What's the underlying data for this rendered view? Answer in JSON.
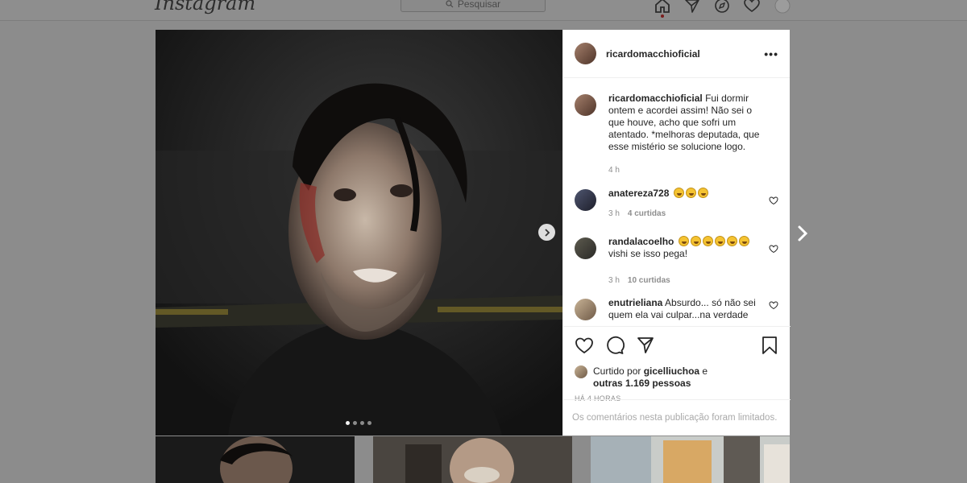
{
  "app": {
    "logo_text": "Instagram"
  },
  "search": {
    "placeholder": "Pesquisar",
    "icon": "search-icon"
  },
  "nav": {
    "icons": [
      "home-icon",
      "direct-icon",
      "explore-icon",
      "activity-heart-icon",
      "profile-avatar"
    ]
  },
  "post": {
    "username": "ricardomacchioficial",
    "more_label": "•••",
    "carousel": {
      "total": 4,
      "current": 1
    },
    "caption": {
      "user": "ricardomacchioficial",
      "text": "Fui dormir ontem e acordei assim! Não sei o que houve, acho que sofri um atentado. *melhoras deputada, que esse mistério se solucione logo.",
      "time": "4 h"
    },
    "comments": [
      {
        "user": "anatereza728",
        "text": "",
        "emoji_count": 3,
        "time": "3 h",
        "likes": "4 curtidas"
      },
      {
        "user": "randalacoelho",
        "text": "vishi se isso pega!",
        "emoji_count": 6,
        "time": "3 h",
        "likes": "10 curtidas"
      },
      {
        "user": "enutrieliana",
        "text": "Absurdo... só não sei quem ela vai culpar...na verdade",
        "emoji_count": 0,
        "time": "",
        "likes": ""
      }
    ],
    "liked_by": {
      "prefix": "Curtido por",
      "user": "gicelliuchoa",
      "suffix": "e",
      "others": "outras 1.169 pessoas"
    },
    "timestamp": "HÁ 4 HORAS",
    "comments_limited": "Os comentários nesta publicação foram limitados."
  },
  "colors": {
    "overlay": "#8c8c8c",
    "modal_bg": "#ffffff",
    "muted_text": "#8e8e8e",
    "text": "#262626"
  }
}
